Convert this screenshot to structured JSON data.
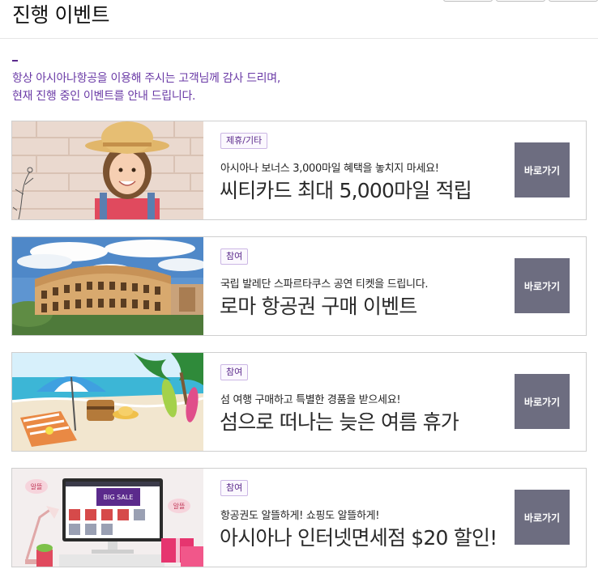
{
  "page": {
    "title": "진행 이벤트"
  },
  "intro": {
    "line1": "항상 아시아나항공을 이용해 주시는 고객님께 감사 드리며,",
    "line2": "현재 진행 중인 이벤트를 안내 드립니다."
  },
  "colors": {
    "accent": "#6a3aa6",
    "button": "#6d6d80",
    "border": "#cfcfcf"
  },
  "events": [
    {
      "badge": "제휴/기타",
      "subtitle": "아시아나 보너스 3,000마일 혜택을 놓치지 마세요!",
      "title": "씨티카드 최대 5,000마일 적립",
      "button_label": "바로가기",
      "image": "girl-in-straw-hat"
    },
    {
      "badge": "참여",
      "subtitle": "국립 발레단 스파르타쿠스 공연 티켓을 드립니다.",
      "title": "로마 항공권 구매 이벤트",
      "button_label": "바로가기",
      "image": "rome-colosseum"
    },
    {
      "badge": "참여",
      "subtitle": "섬 여행 구매하고 특별한 경품을 받으세요!",
      "title": "섬으로 떠나는 늦은 여름 휴가",
      "button_label": "바로가기",
      "image": "tropical-beach"
    },
    {
      "badge": "참여",
      "subtitle": "항공권도 알뜰하게! 쇼핑도 알뜰하게!",
      "title": "아시아나 인터넷면세점 $20 할인!",
      "button_label": "바로가기",
      "image": "online-duty-free-monitor",
      "image_text": {
        "sale": "BIG SALE",
        "tag1": "알뜰",
        "tag2": "알뜰"
      }
    }
  ]
}
